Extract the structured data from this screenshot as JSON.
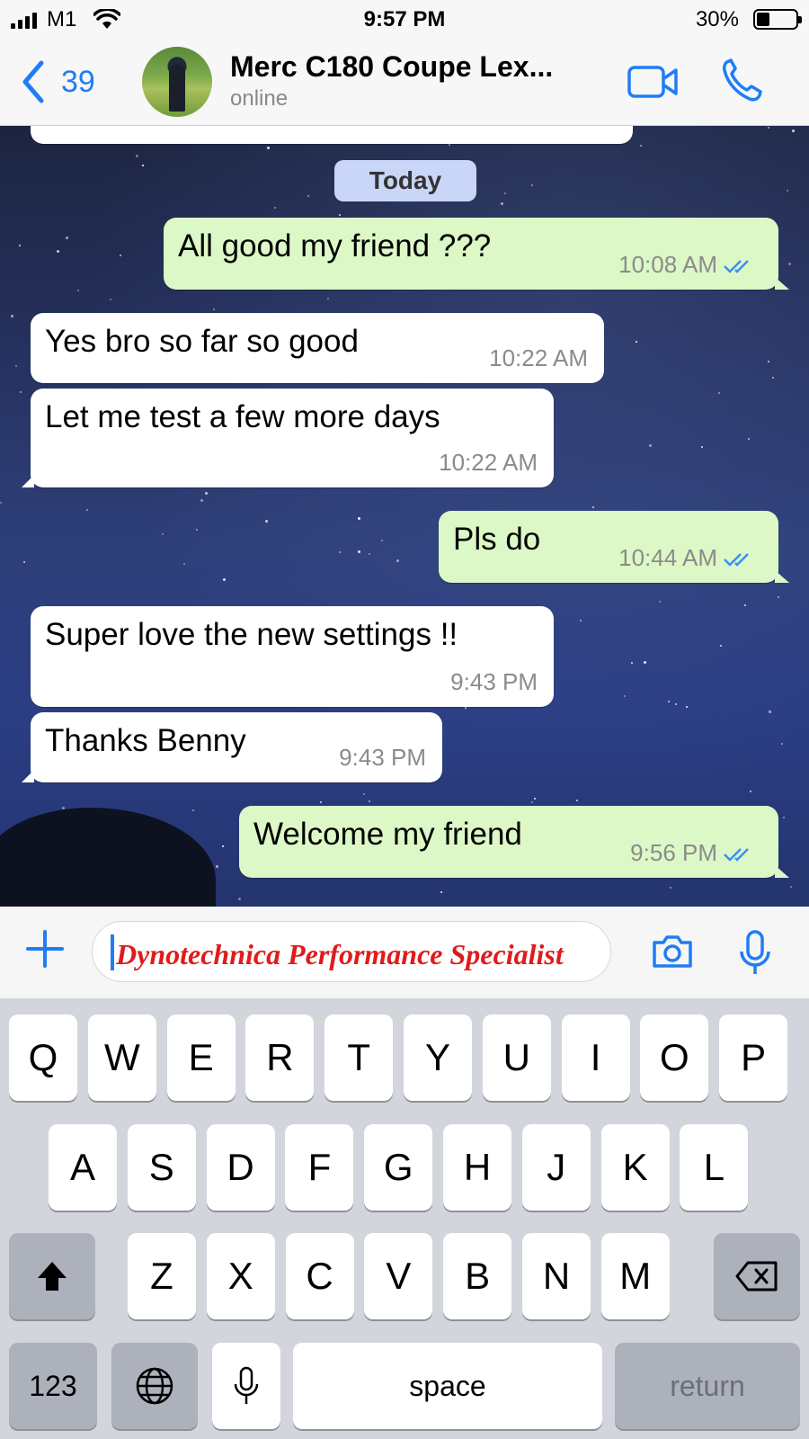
{
  "status_bar": {
    "carrier": "M1",
    "time": "9:57 PM",
    "battery": "30%"
  },
  "header": {
    "back_count": "39",
    "contact_name": "Merc C180 Coupe Lex...",
    "contact_status": "online"
  },
  "chat": {
    "date_label": "Today",
    "messages": [
      {
        "direction": "out",
        "text": "All good my friend ???",
        "time": "10:08 AM",
        "read": true
      },
      {
        "direction": "in",
        "text": "Yes bro so far so good",
        "time": "10:22 AM"
      },
      {
        "direction": "in",
        "text": "Let me test a few more days",
        "time": "10:22 AM"
      },
      {
        "direction": "out",
        "text": "Pls do",
        "time": "10:44 AM",
        "read": true
      },
      {
        "direction": "in",
        "text": "Super love the new settings !!",
        "time": "9:43 PM"
      },
      {
        "direction": "in",
        "text": "Thanks Benny",
        "time": "9:43 PM"
      },
      {
        "direction": "out",
        "text": "Welcome my friend",
        "time": "9:56 PM",
        "read": true
      }
    ]
  },
  "composer": {
    "text": "Dynotechnica Performance Specialist"
  },
  "keyboard": {
    "row1": [
      "Q",
      "W",
      "E",
      "R",
      "T",
      "Y",
      "U",
      "I",
      "O",
      "P"
    ],
    "row2": [
      "A",
      "S",
      "D",
      "F",
      "G",
      "H",
      "J",
      "K",
      "L"
    ],
    "row3": [
      "Z",
      "X",
      "C",
      "V",
      "B",
      "N",
      "M"
    ],
    "numbers_label": "123",
    "space_label": "space",
    "return_label": "return"
  },
  "colors": {
    "accent": "#1f7df5",
    "outgoing_bubble": "#dcf8c6",
    "incoming_bubble": "#ffffff",
    "read_ticks": "#3a8ef5",
    "composer_text": "#e01b1b"
  }
}
